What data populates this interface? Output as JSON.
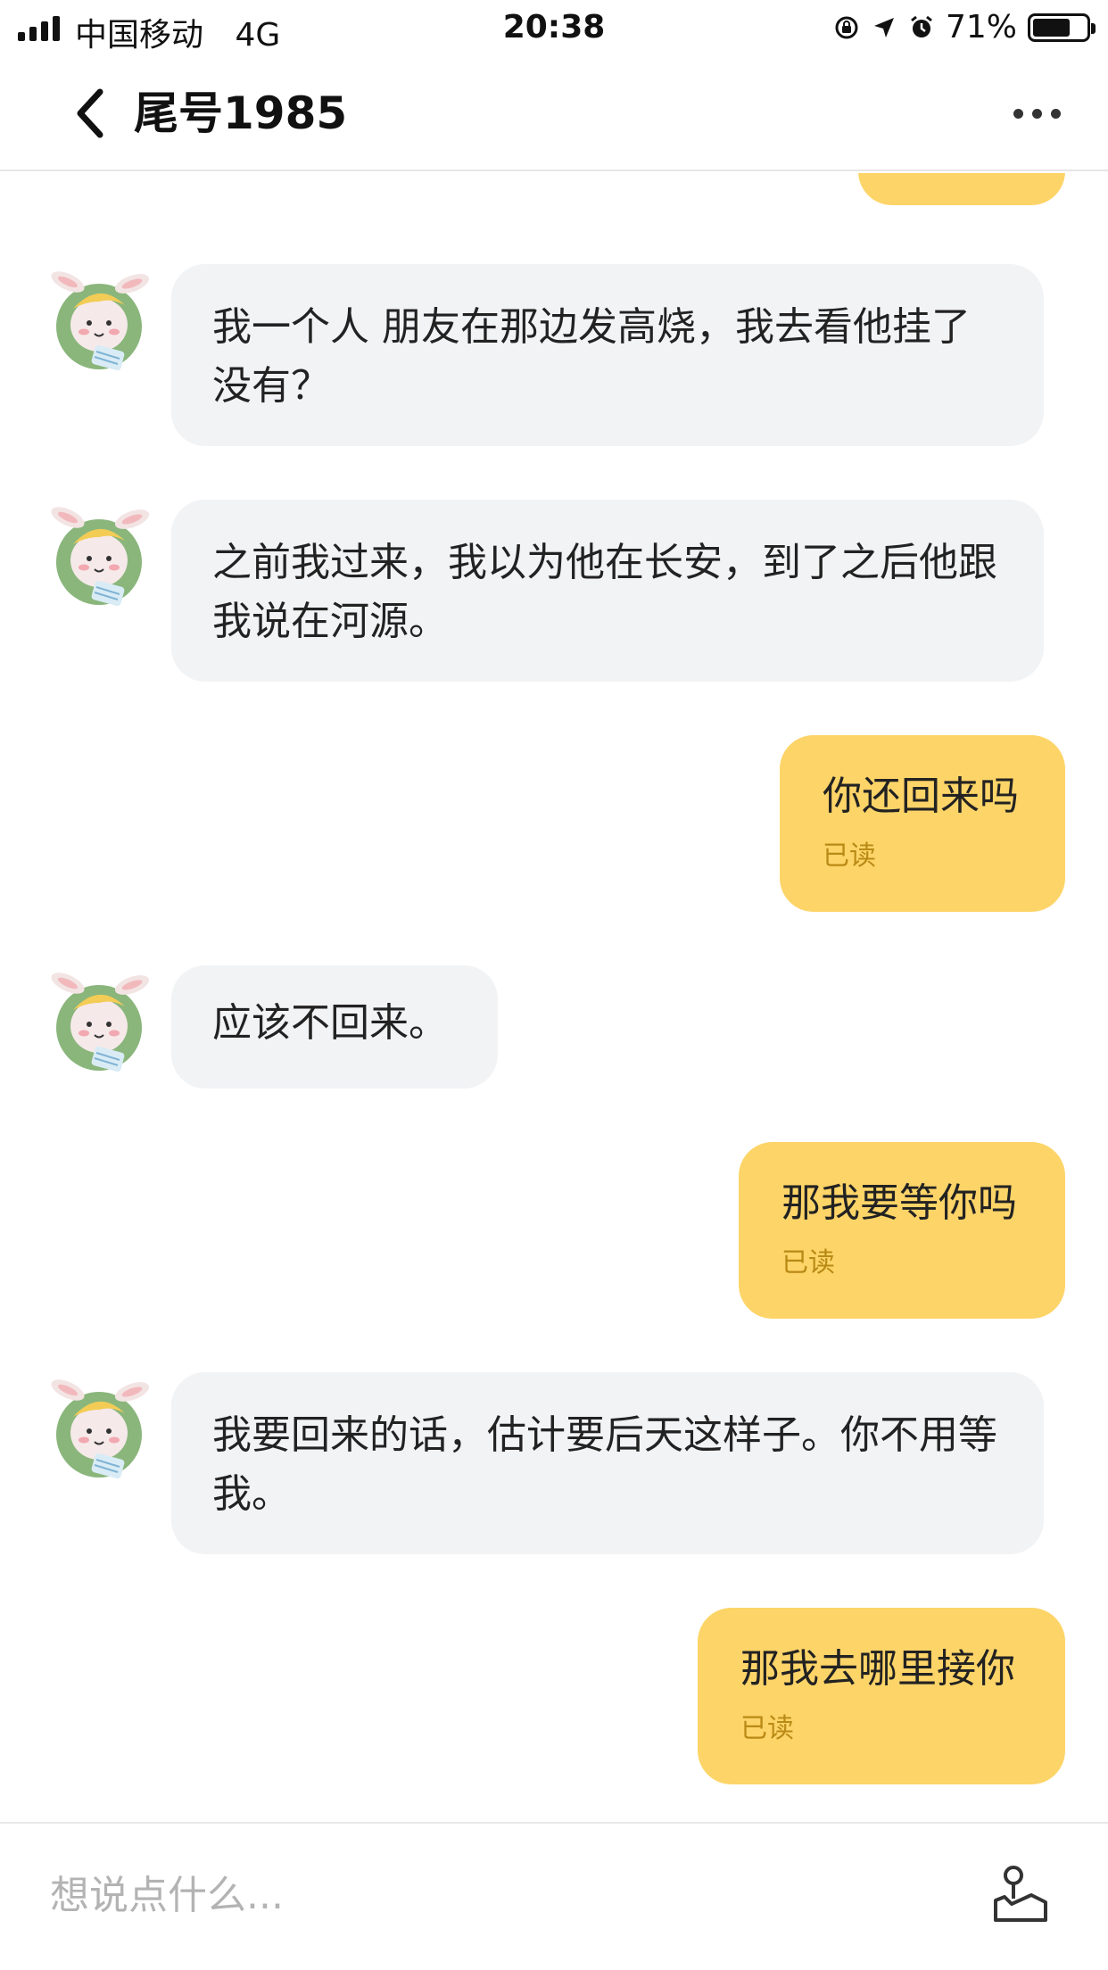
{
  "status_bar": {
    "carrier": "中国移动",
    "network": "4G",
    "time": "20:38",
    "battery": "71%",
    "battery_level": 0.71
  },
  "header": {
    "title": "尾号1985"
  },
  "messages": [
    {
      "direction": "in",
      "text": "我一个人 朋友在那边发高烧，我去看他挂了没有？"
    },
    {
      "direction": "in",
      "text": "之前我过来，我以为他在长安，到了之后他跟我说在河源。"
    },
    {
      "direction": "out",
      "text": "你还回来吗",
      "status": "已读"
    },
    {
      "direction": "in",
      "text": "应该不回来。"
    },
    {
      "direction": "out",
      "text": "那我要等你吗",
      "status": "已读"
    },
    {
      "direction": "in",
      "text": "我要回来的话，估计要后天这样子。你不用等我。"
    },
    {
      "direction": "out",
      "text": "那我去哪里接你",
      "status": "已读"
    }
  ],
  "input": {
    "placeholder": "想说点什么..."
  },
  "colors": {
    "outgoing_bubble": "#fdd468",
    "incoming_bubble": "#f2f3f5",
    "read_status": "#b98a15",
    "avatar_ring": "#8ab67c"
  },
  "icons": {
    "back": "chevron-left-icon",
    "more": "more-dots-icon",
    "share": "location-share-icon",
    "avatar": "bunny-avatar-icon"
  }
}
